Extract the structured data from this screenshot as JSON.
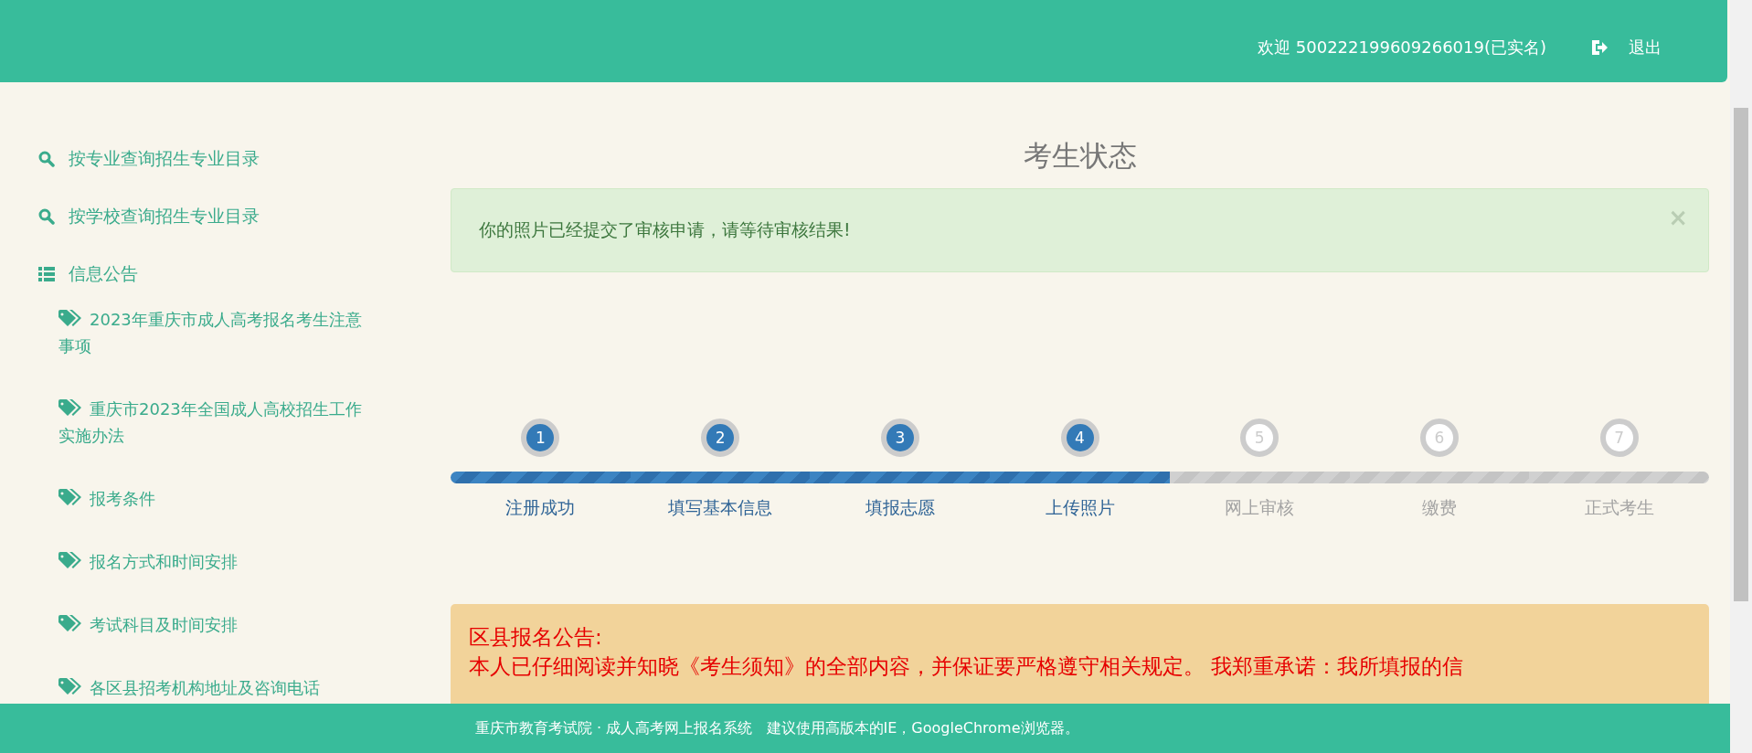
{
  "header": {
    "welcome": "欢迎 500222199609266019(已实名)",
    "logout": "退出"
  },
  "sidebar": {
    "items": [
      {
        "kind": "search",
        "label": "按专业查询招生专业目录"
      },
      {
        "kind": "search",
        "label": "按学校查询招生专业目录"
      },
      {
        "kind": "list",
        "label": "信息公告",
        "children": [
          {
            "label": "2023年重庆市成人高考报名考生注意事项"
          },
          {
            "label": "重庆市2023年全国成人高校招生工作实施办法"
          },
          {
            "label": "报考条件"
          },
          {
            "label": "报名方式和时间安排"
          },
          {
            "label": "考试科目及时间安排"
          },
          {
            "label": "各区县招考机构地址及咨询电话"
          }
        ]
      }
    ]
  },
  "main": {
    "title": "考生状态",
    "alert": {
      "text": "你的照片已经提交了审核申请，请等待审核结果!",
      "close": "×"
    },
    "steps": [
      {
        "number": "1",
        "label": "注册成功",
        "done": true
      },
      {
        "number": "2",
        "label": "填写基本信息",
        "done": true
      },
      {
        "number": "3",
        "label": "填报志愿",
        "done": true
      },
      {
        "number": "4",
        "label": "上传照片",
        "done": true
      },
      {
        "number": "5",
        "label": "网上审核",
        "done": false
      },
      {
        "number": "6",
        "label": "缴费",
        "done": false
      },
      {
        "number": "7",
        "label": "正式考生",
        "done": false
      }
    ],
    "notice": {
      "title": "区县报名公告:",
      "text": "本人已仔细阅读并知晓《考生须知》的全部内容，并保证要严格遵守相关规定。 我郑重承诺：我所填报的信"
    }
  },
  "footer": {
    "text": "重庆市教育考试院 · 成人高考网上报名系统   建议使用高版本的IE，GoogleChrome浏览器。"
  }
}
